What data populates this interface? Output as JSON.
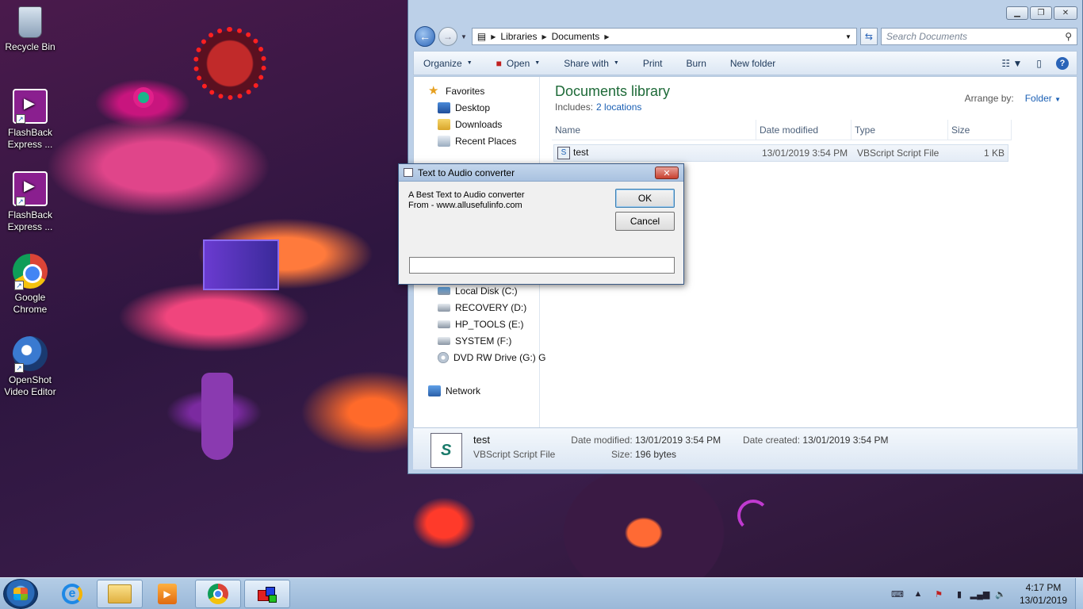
{
  "desktop": {
    "icons": [
      {
        "label": "Recycle Bin"
      },
      {
        "label": "FlashBack Express ..."
      },
      {
        "label": "FlashBack Express ..."
      },
      {
        "label": "Google Chrome"
      },
      {
        "label": "OpenShot Video Editor"
      }
    ]
  },
  "explorer": {
    "address": {
      "crumbs": [
        "Libraries",
        "Documents"
      ]
    },
    "search_placeholder": "Search Documents",
    "toolbar": {
      "organize": "Organize",
      "open": "Open",
      "share_with": "Share with",
      "print": "Print",
      "burn": "Burn",
      "new_folder": "New folder"
    },
    "nav": {
      "favorites": "Favorites",
      "desktop": "Desktop",
      "downloads": "Downloads",
      "recent_places": "Recent Places",
      "local_disk": "Local Disk (C:)",
      "recovery": "RECOVERY (D:)",
      "hp_tools": "HP_TOOLS (E:)",
      "system": "SYSTEM (F:)",
      "dvd": "DVD RW Drive (G:) G",
      "network": "Network"
    },
    "library": {
      "title": "Documents library",
      "includes_label": "Includes:",
      "includes_link": "2 locations",
      "arrange_label": "Arrange by:",
      "arrange_value": "Folder"
    },
    "columns": {
      "name": "Name",
      "date": "Date modified",
      "type": "Type",
      "size": "Size"
    },
    "files": [
      {
        "name": "test",
        "date": "13/01/2019 3:54 PM",
        "type": "VBScript Script File",
        "size": "1 KB"
      }
    ],
    "details": {
      "name": "test",
      "type": "VBScript Script File",
      "modified_label": "Date modified:",
      "modified": "13/01/2019 3:54 PM",
      "size_label": "Size:",
      "size": "196 bytes",
      "created_label": "Date created:",
      "created": "13/01/2019 3:54 PM"
    }
  },
  "dialog": {
    "title": "Text to Audio converter",
    "line1": "A Best Text to Audio converter",
    "line2": "From - www.allusefulinfo.com",
    "ok": "OK",
    "cancel": "Cancel",
    "input_value": ""
  },
  "taskbar": {
    "time": "4:17 PM",
    "date": "13/01/2019"
  }
}
